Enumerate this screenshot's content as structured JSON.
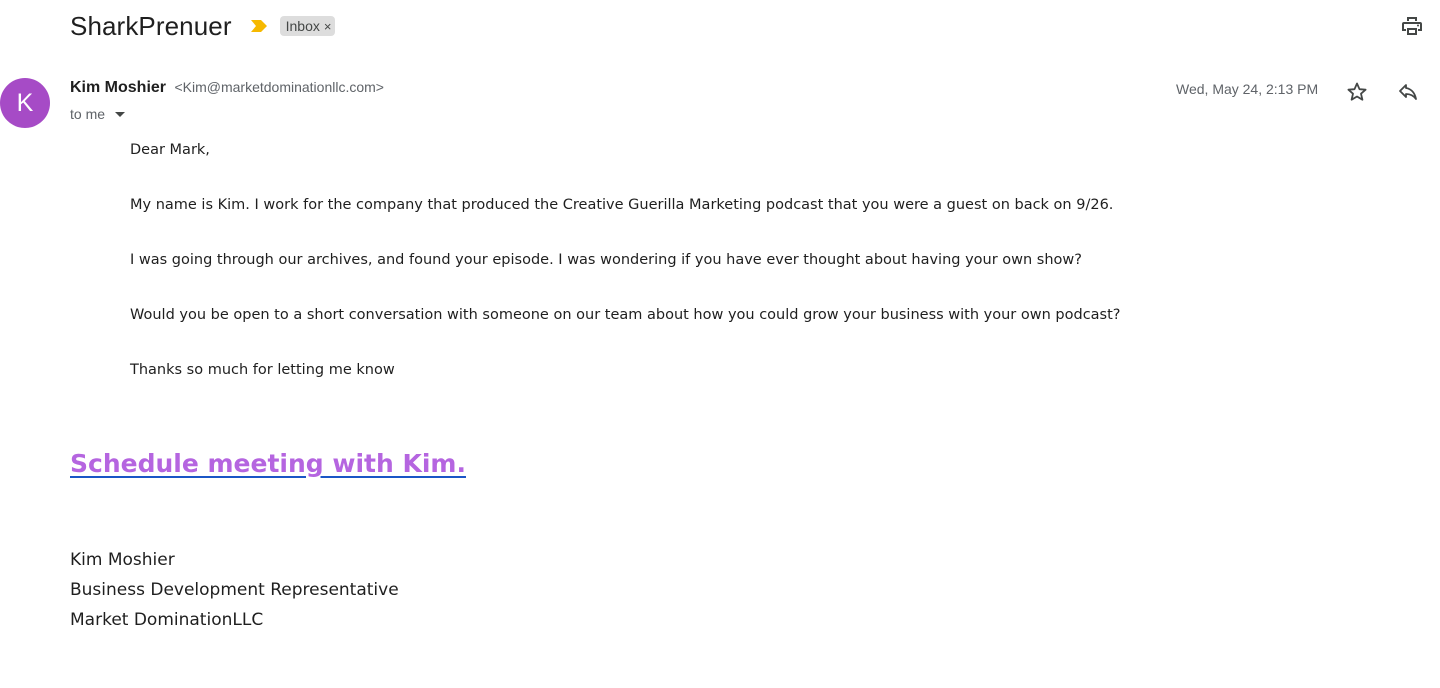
{
  "header": {
    "subject": "SharkPrenuer",
    "label_chip": "Inbox",
    "label_remove": "×",
    "importance_color": "#f6b900"
  },
  "icons": {
    "print": "print-icon",
    "star": "star-icon",
    "reply": "reply-icon",
    "importance": "importance-marker-icon",
    "dropdown": "chevron-down-icon"
  },
  "message": {
    "avatar_letter": "K",
    "avatar_color": "#a64bc6",
    "sender_name": "Kim Moshier",
    "sender_email": "<Kim@marketdominationllc.com>",
    "recipient": "to me",
    "date": "Wed, May 24, 2:13 PM"
  },
  "body": {
    "greeting": "Dear Mark,",
    "para1": "My name is Kim. I work for the company that produced the Creative Guerilla Marketing podcast that you were a guest on back on 9/26.",
    "para2": "I was going through our archives, and found your episode. I was wondering if you have ever thought about having your own show?",
    "para3": "Would you be open to a short conversation with someone on our team about how you could grow your business with your own podcast?",
    "closing": "Thanks so much for letting me know",
    "link_text": "Schedule meeting with Kim.",
    "link_color": "#b565e0"
  },
  "signature": {
    "name": "Kim Moshier",
    "title": "Business Development Representative",
    "company": "Market DominationLLC"
  }
}
